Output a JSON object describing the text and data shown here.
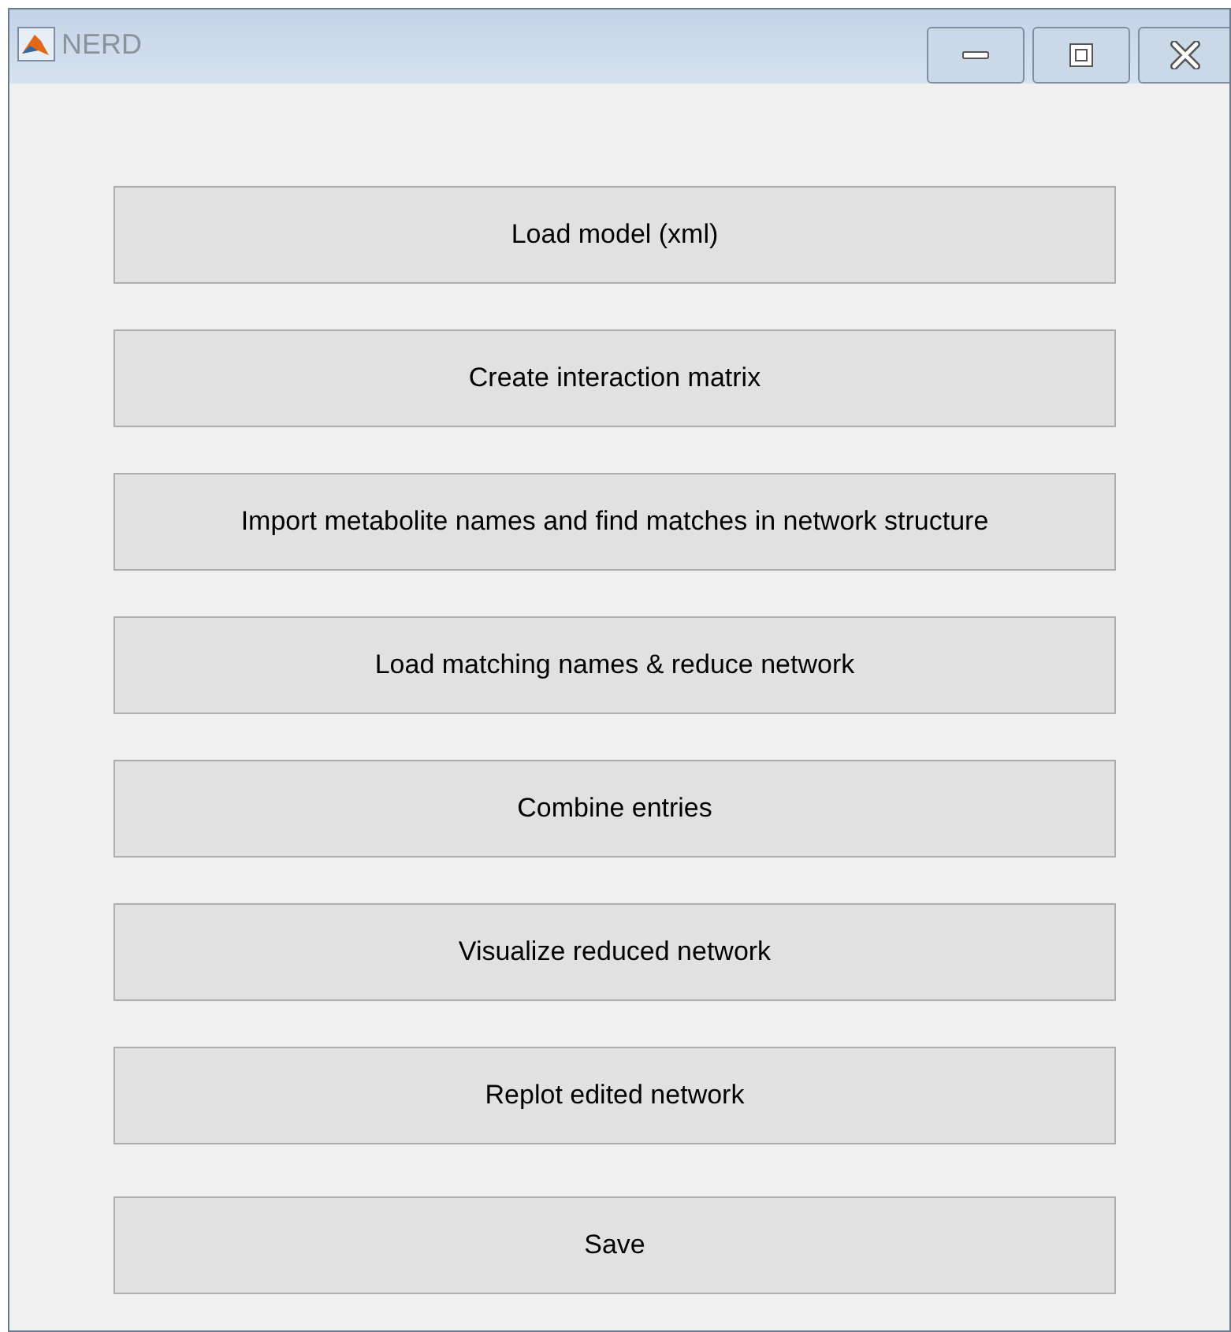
{
  "window": {
    "title": "NERD"
  },
  "buttons": [
    "Load model (xml)",
    "Create interaction matrix",
    "Import metabolite names and find matches in network structure",
    "Load matching names & reduce network",
    "Combine entries",
    "Visualize reduced network",
    "Replot edited network",
    "Save"
  ]
}
